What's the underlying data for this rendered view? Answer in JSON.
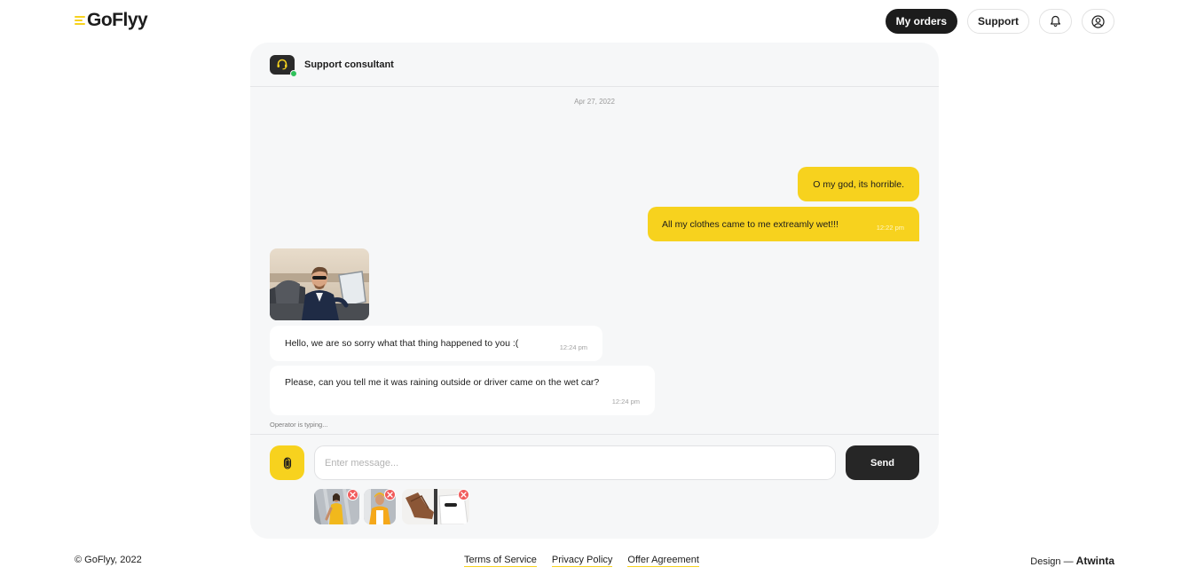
{
  "brand": {
    "name": "GoFlyy",
    "accent_color": "#f7d21e"
  },
  "header": {
    "my_orders_label": "My orders",
    "support_label": "Support",
    "notifications_icon": "bell-icon",
    "profile_icon": "user-circle-icon"
  },
  "chat": {
    "agent_name": "Support consultant",
    "agent_status": "online",
    "date": "Apr 27, 2022",
    "messages": [
      {
        "direction": "out",
        "text": "O my god, its horrible.",
        "time": ""
      },
      {
        "direction": "out",
        "text": "All my clothes came to me extreamly wet!!!",
        "time": "12:22 pm"
      },
      {
        "direction": "in",
        "type": "image",
        "subject": "man in sunglasses sitting in a car"
      },
      {
        "direction": "in",
        "text": "Hello, we are so sorry what that thing happened to you :(",
        "time": "12:24 pm"
      },
      {
        "direction": "in",
        "text": "Please, can you tell me it was raining outside or driver came on the wet car?",
        "time": "12:24 pm"
      }
    ],
    "typing_text": "Operator is typing...",
    "composer": {
      "placeholder": "Enter message...",
      "value": "",
      "send_label": "Send",
      "attach_icon": "paperclip-icon",
      "attachments": [
        {
          "subject": "woman in yellow outfit"
        },
        {
          "subject": "woman in yellow jacket"
        },
        {
          "subject": "brown boots and white shirt"
        }
      ]
    }
  },
  "footer": {
    "copyright": "© GoFlyy, 2022",
    "links": [
      "Terms of Service",
      "Privacy Policy",
      "Offer Agreement"
    ],
    "credit_prefix": "Design — ",
    "credit_name": "Atwinta"
  }
}
